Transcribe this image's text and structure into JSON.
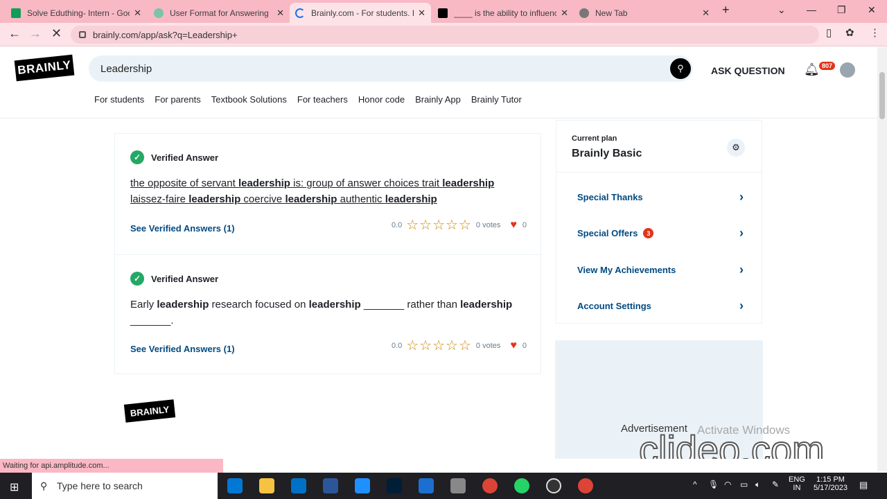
{
  "browser": {
    "tabs": [
      {
        "title": "Solve Eduthing- Intern - Goo",
        "color": "#0f9d58"
      },
      {
        "title": "User Format for Answering",
        "color": "#7cc3a7"
      },
      {
        "title": "Brainly.com - For students. B",
        "color": "#1a73e8"
      },
      {
        "title": "____ is the ability to influenc",
        "color": "#000000"
      },
      {
        "title": "New Tab",
        "color": "#555555"
      }
    ],
    "url": "brainly.com/app/ask?q=Leadership+",
    "status": "Waiting for api.amplitude.com..."
  },
  "header": {
    "logo": "BRAINLY",
    "search_value": "Leadership",
    "ask_button": "ASK QUESTION",
    "notifications": "807",
    "nav": [
      "For students",
      "For parents",
      "Textbook Solutions",
      "For teachers",
      "Honor code",
      "Brainly App",
      "Brainly Tutor"
    ]
  },
  "answers": [
    {
      "badge": "Verified Answer",
      "link": "See Verified Answers (1)",
      "rating": "0.0",
      "stars": "☆☆☆☆☆",
      "votes": "0 votes",
      "thanks": "0"
    },
    {
      "badge": "Verified Answer",
      "link": "See Verified Answers (1)",
      "rating": "0.0",
      "stars": "☆☆☆☆☆",
      "votes": "0 votes",
      "thanks": "0"
    }
  ],
  "answer_texts": {
    "a1": [
      "the opposite of servant ",
      "leadership",
      " is: group of answer choices trait ",
      "leadership",
      " laissez-faire ",
      "leadership",
      " coercive ",
      "leadership",
      " authentic ",
      "leadership"
    ],
    "a2": [
      "Early ",
      "leadership",
      " research focused on ",
      "leadership",
      " _______ rather than ",
      "leadership",
      " _______."
    ]
  },
  "sidebar": {
    "plan_label": "Current plan",
    "plan_name": "Brainly Basic",
    "items": [
      {
        "label": "Special Thanks",
        "count": ""
      },
      {
        "label": "Special Offers",
        "count": "3"
      },
      {
        "label": "View My Achievements",
        "count": ""
      },
      {
        "label": "Account Settings",
        "count": ""
      }
    ]
  },
  "ad_label": "Advertisement",
  "footer_logo": "BRAINLY",
  "overlay": {
    "windows": "Activate Windows",
    "clideo": "clideo.com"
  },
  "taskbar": {
    "search_placeholder": "Type here to search",
    "lang": "ENG",
    "region": "IN",
    "time": "1:15 PM",
    "date": "5/17/2023"
  }
}
